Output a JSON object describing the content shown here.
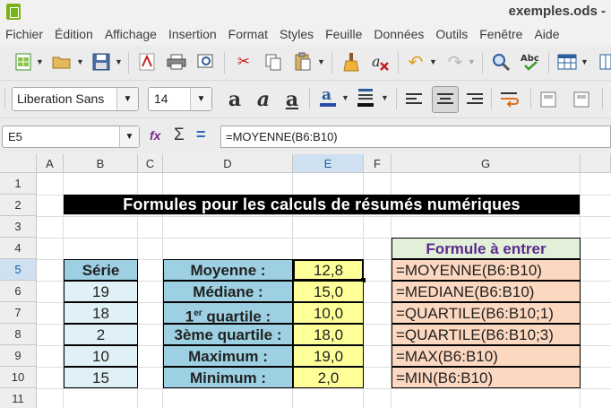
{
  "window": {
    "title": "exemples.ods -"
  },
  "menu": [
    "Fichier",
    "Édition",
    "Affichage",
    "Insertion",
    "Format",
    "Styles",
    "Feuille",
    "Données",
    "Outils",
    "Fenêtre",
    "Aide"
  ],
  "toolbar": {
    "font_name": "Liberation Sans",
    "font_size": "14",
    "icons": [
      "new-spreadsheet",
      "open-folder",
      "save",
      "export-pdf",
      "print",
      "print-preview",
      "cut",
      "copy",
      "paste",
      "clone-formatting",
      "clear-formatting",
      "undo",
      "redo",
      "find-replace",
      "spellcheck",
      "row-column-table",
      "bold",
      "italic",
      "underline",
      "font-color",
      "highlight-color",
      "align-left",
      "align-center",
      "align-right",
      "wrap-text",
      "merge-cells"
    ]
  },
  "formula_bar": {
    "cell_ref": "E5",
    "formula": "=MOYENNE(B6:B10)",
    "fx_label": "fx",
    "sigma_label": "Σ",
    "equals_label": "="
  },
  "columns": [
    "A",
    "B",
    "C",
    "D",
    "E",
    "F",
    "G"
  ],
  "selected_column": "E",
  "rows": [
    "1",
    "2",
    "3",
    "4",
    "5",
    "6",
    "7",
    "8",
    "9",
    "10",
    "11"
  ],
  "selected_row": "5",
  "sheet": {
    "title": "Formules pour les calculs de résumés numériques",
    "serie_header": "Série",
    "serie_values": [
      "19",
      "18",
      "2",
      "10",
      "15"
    ],
    "stats_labels": [
      "Moyenne :",
      "Médiane :",
      "1",
      "3ème quartile :",
      "Maximum :",
      "Minimum :"
    ],
    "quartile1_sup": "er",
    "quartile1_rest": " quartile :",
    "stats_values": [
      "12,8",
      "15,0",
      "10,0",
      "18,0",
      "19,0",
      "2,0"
    ],
    "formula_header": "Formule à entrer",
    "formulas": [
      "=MOYENNE(B6:B10)",
      "=MEDIANE(B6:B10)",
      "=QUARTILE(B6:B10;1)",
      "=QUARTILE(B6:B10;3)",
      "=MAX(B6:B10)",
      "=MIN(B6:B10)"
    ]
  },
  "colors": {
    "header_blue": "#9dd0e3",
    "serie_light_blue": "#dff0f7",
    "value_yellow": "#ffff99",
    "formula_peach": "#fdd8c0",
    "formula_header_green": "#e2efd9",
    "title_black": "#000000",
    "formula_header_text": "#5b2a8c"
  }
}
